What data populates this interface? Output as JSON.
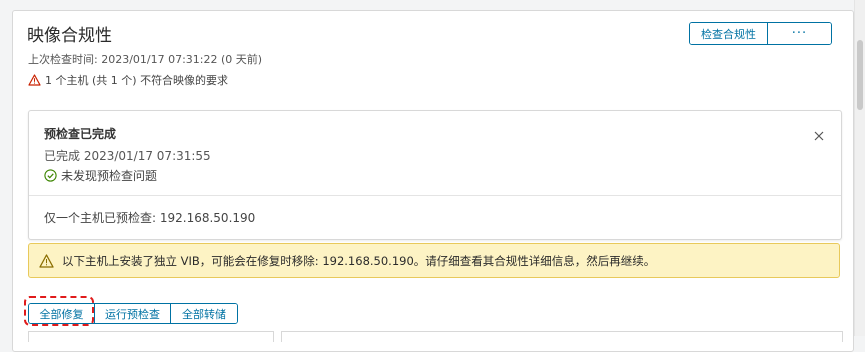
{
  "header": {
    "title": "映像合规性",
    "last_check": "上次检查时间: 2023/01/17 07:31:22 (0 天前)",
    "warning_text": "1 个主机 (共 1 个) 不符合映像的要求",
    "check_button_label": "检查合规性",
    "more_button_label": "···"
  },
  "precheck_panel": {
    "title": "预检查已完成",
    "completed": "已完成 2023/01/17 07:31:55",
    "status": "未发现预检查问题",
    "host_info": "仅一个主机已预检查: 192.168.50.190"
  },
  "alert": {
    "text": "以下主机上安装了独立 VIB，可能会在修复时移除: 192.168.50.190。请仔细查看其合规性详细信息，然后再继续。"
  },
  "actions": {
    "remediate_all": "全部修复",
    "run_precheck": "运行预检查",
    "stage_all": "全部转储"
  },
  "colors": {
    "accent": "#0072a3",
    "warning_bg": "#fdf3c4",
    "warning_border": "#e8c95b",
    "success": "#3c8500",
    "highlight": "#e01b1b"
  }
}
